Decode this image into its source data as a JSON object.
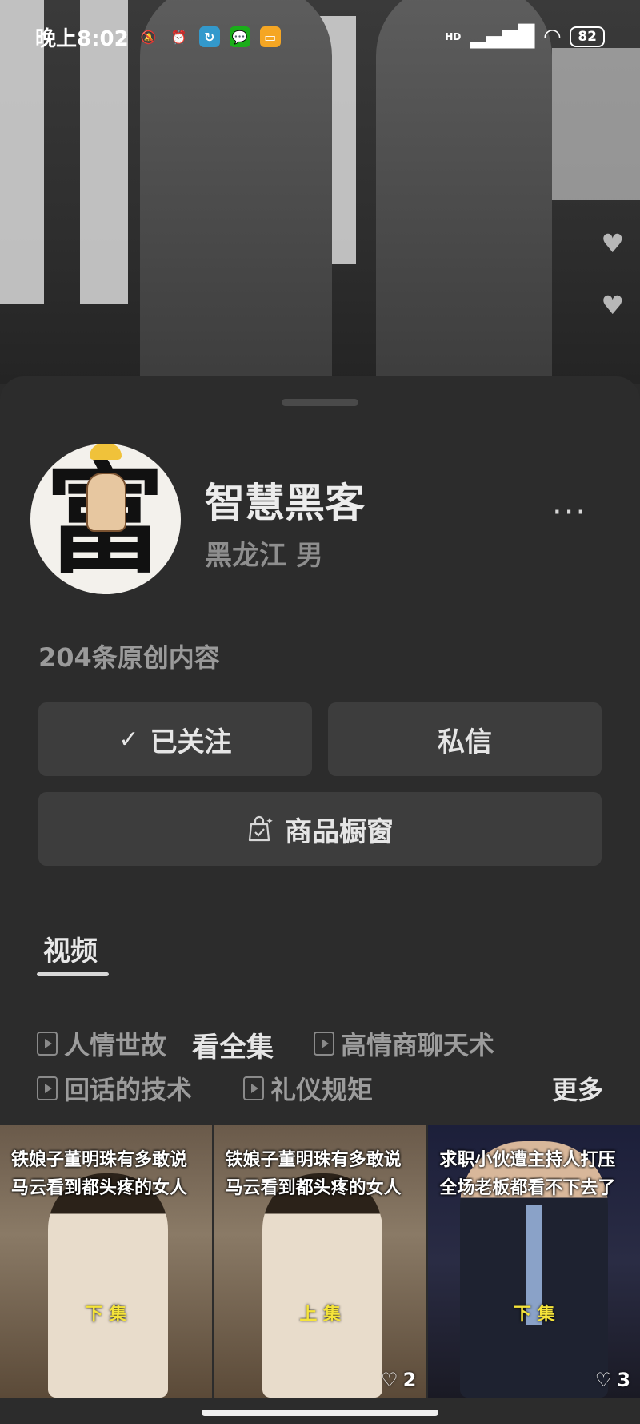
{
  "status_bar": {
    "time": "晚上8:02",
    "battery": "82",
    "network_badge": "HD",
    "icons": [
      "mute-icon",
      "alarm-icon",
      "app-icon",
      "wechat-icon",
      "message-icon",
      "signal-icon",
      "wifi-icon",
      "battery-icon"
    ]
  },
  "profile": {
    "name": "智慧黑客",
    "location_gender": "黑龙江 男",
    "more_label": "···",
    "original_count": "204条原创内容"
  },
  "actions": {
    "follow_label": "已关注",
    "message_label": "私信",
    "shop_label": "商品橱窗"
  },
  "tabs": {
    "video_label": "视频"
  },
  "collections": {
    "items": [
      "人情世故",
      "高情商聊天术",
      "回话的技术",
      "礼仪规矩"
    ],
    "see_all": "看全集",
    "more": "更多"
  },
  "videos": [
    {
      "title": "铁娘子董明珠有多敢说马云看到都头疼的女人",
      "tag": "下 集",
      "likes": ""
    },
    {
      "title": "铁娘子董明珠有多敢说马云看到都头疼的女人",
      "tag": "上 集",
      "likes": "2"
    },
    {
      "title": "求职小伙遭主持人打压全场老板都看不下去了",
      "tag": "下 集",
      "likes": "3"
    }
  ],
  "colors": {
    "sheet_bg": "#2c2c2c",
    "button_bg": "#3d3d3d",
    "tag_yellow": "#f5e43a"
  }
}
